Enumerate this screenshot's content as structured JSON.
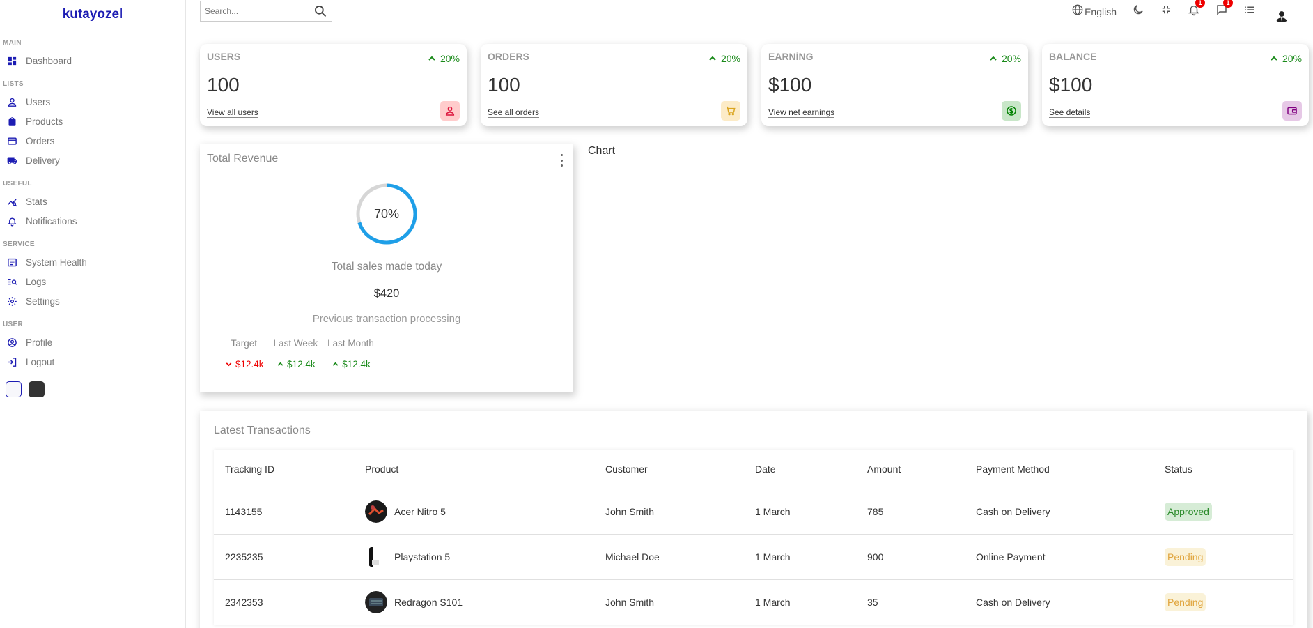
{
  "app": {
    "logo": "kutayozel"
  },
  "sidebar": {
    "sections": [
      {
        "title": "MAIN",
        "items": [
          {
            "label": "Dashboard",
            "icon": "dashboard-icon"
          }
        ]
      },
      {
        "title": "LISTS",
        "items": [
          {
            "label": "Users",
            "icon": "user-icon"
          },
          {
            "label": "Products",
            "icon": "shopping-bag-icon"
          },
          {
            "label": "Orders",
            "icon": "credit-card-icon"
          },
          {
            "label": "Delivery",
            "icon": "truck-icon"
          }
        ]
      },
      {
        "title": "USEFUL",
        "items": [
          {
            "label": "Stats",
            "icon": "stats-icon"
          },
          {
            "label": "Notifications",
            "icon": "bell-icon"
          }
        ]
      },
      {
        "title": "SERVICE",
        "items": [
          {
            "label": "System Health",
            "icon": "system-health-icon"
          },
          {
            "label": "Logs",
            "icon": "logs-icon"
          },
          {
            "label": "Settings",
            "icon": "settings-icon"
          }
        ]
      },
      {
        "title": "USER",
        "items": [
          {
            "label": "Profile",
            "icon": "profile-icon"
          },
          {
            "label": "Logout",
            "icon": "logout-icon"
          }
        ]
      }
    ]
  },
  "topbar": {
    "search_placeholder": "Search...",
    "language": "English",
    "notifications_count": "1",
    "messages_count": "1"
  },
  "widgets": [
    {
      "title": "USERS",
      "counter": "100",
      "percentage": "20%",
      "link": "View all users",
      "icon": "person-icon",
      "icon_color": "#dc143c",
      "icon_bg": "#ffcccc"
    },
    {
      "title": "ORDERS",
      "counter": "100",
      "percentage": "20%",
      "link": "See all orders",
      "icon": "cart-icon",
      "icon_color": "#daa520",
      "icon_bg": "#fcebc7"
    },
    {
      "title": "EARNİNG",
      "counter": "$100",
      "percentage": "20%",
      "link": "View net earnings",
      "icon": "dollar-icon",
      "icon_color": "#008000",
      "icon_bg": "#c8e6c8"
    },
    {
      "title": "BALANCE",
      "counter": "$100",
      "percentage": "20%",
      "link": "See details",
      "icon": "wallet-icon",
      "icon_color": "#800080",
      "icon_bg": "#e6c8e6"
    }
  ],
  "featured": {
    "title": "Total Revenue",
    "progress": 70,
    "progress_label": "70%",
    "sales_title": "Total sales made today",
    "amount": "$420",
    "description": "Previous transaction processing",
    "summary": [
      {
        "title": "Target",
        "value": "$12.4k",
        "trend": "down"
      },
      {
        "title": "Last Week",
        "value": "$12.4k",
        "trend": "up"
      },
      {
        "title": "Last Month",
        "value": "$12.4k",
        "trend": "up"
      }
    ]
  },
  "chart": {
    "title": "Chart"
  },
  "latest": {
    "title": "Latest Transactions",
    "columns": [
      "Tracking ID",
      "Product",
      "Customer",
      "Date",
      "Amount",
      "Payment Method",
      "Status"
    ],
    "rows": [
      {
        "id": "1143155",
        "product": "Acer Nitro 5",
        "customer": "John Smith",
        "date": "1 March",
        "amount": "785",
        "method": "Cash on Delivery",
        "status": "Approved"
      },
      {
        "id": "2235235",
        "product": "Playstation 5",
        "customer": "Michael Doe",
        "date": "1 March",
        "amount": "900",
        "method": "Online Payment",
        "status": "Pending"
      },
      {
        "id": "2342353",
        "product": "Redragon S101",
        "customer": "John Smith",
        "date": "1 March",
        "amount": "35",
        "method": "Cash on Delivery",
        "status": "Pending"
      }
    ]
  },
  "colors": {
    "accent": "#1c1cb3",
    "positive": "#1a8a1a",
    "negative": "#ee0000",
    "progress": "#1e9fe8"
  }
}
